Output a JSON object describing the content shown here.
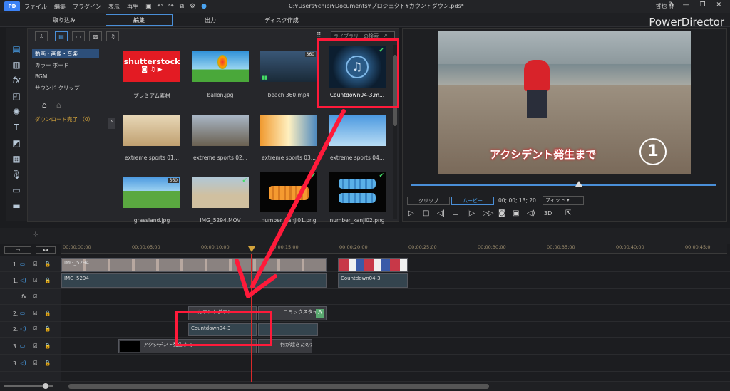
{
  "menu": [
    "ファイル",
    "編集",
    "プラグイン",
    "表示",
    "再生"
  ],
  "file_path": "C:¥Users¥chibi¥Documents¥プロジェクト¥カウントダウン.pds*",
  "user_name": "哲也 林",
  "brand": "PowerDirector",
  "modes": [
    "取り込み",
    "編集",
    "出力",
    "ディスク作成"
  ],
  "library": {
    "search_placeholder": "ライブラリーの検索",
    "categories": [
      "動画・画像・音楽",
      "カラー ボード",
      "BGM",
      "サウンド クリップ"
    ],
    "download_status": "ダウンロード完了 （0）",
    "items": [
      {
        "label": "プレミアム素材",
        "badge": ""
      },
      {
        "label": "ballon.jpg",
        "badge": ""
      },
      {
        "label": "beach 360.mp4",
        "badge": "360"
      },
      {
        "label": "Countdown04-3.m...",
        "badge": ""
      },
      {
        "label": "extreme sports 01...",
        "badge": ""
      },
      {
        "label": "extreme sports 02...",
        "badge": ""
      },
      {
        "label": "extreme sports 03...",
        "badge": ""
      },
      {
        "label": "extreme sports 04...",
        "badge": ""
      },
      {
        "label": "grassland.jpg",
        "badge": "360"
      },
      {
        "label": "IMG_5294.MOV",
        "badge": ""
      },
      {
        "label": "number_kanji01.png",
        "badge": ""
      },
      {
        "label": "number_kanji02.png",
        "badge": ""
      }
    ]
  },
  "preview": {
    "overlay_text": "アクシデント発生まで",
    "overlay_number": "1",
    "clip_tab": "クリップ",
    "movie_tab": "ムービー",
    "timecode": "00; 00; 13; 20",
    "fit": "フィット",
    "mode_3d": "3D"
  },
  "timeline": {
    "ticks": [
      "00;00;00;00",
      "00;00;05;00",
      "00;00;10;00",
      "00;00;15;00",
      "00;00;20;00",
      "00;00;25;00",
      "00;00;30;00",
      "00;00;35;00",
      "00;00;40;00",
      "00;00;45;0"
    ],
    "tracks": [
      {
        "label": "1."
      },
      {
        "label": "1."
      },
      {
        "label": "fx"
      },
      {
        "label": "2."
      },
      {
        "label": "2."
      },
      {
        "label": "3."
      },
      {
        "label": "3."
      }
    ],
    "clips": {
      "img5294_video": "IMG_5294",
      "img5294_audio": "IMG_5294",
      "countdown_audio_top": "Countdown04-3",
      "clip_2a": "カウントダウン",
      "clip_2b": "コミックスタイル",
      "clip_2a_audio": "Countdown04-3",
      "clip_3a": "アクシデント発生まで",
      "clip_3b": "何が起きたのか"
    }
  },
  "colors": {
    "accent": "#4a8fd8",
    "highlight": "#ff1a3a",
    "check": "#44dd66"
  }
}
